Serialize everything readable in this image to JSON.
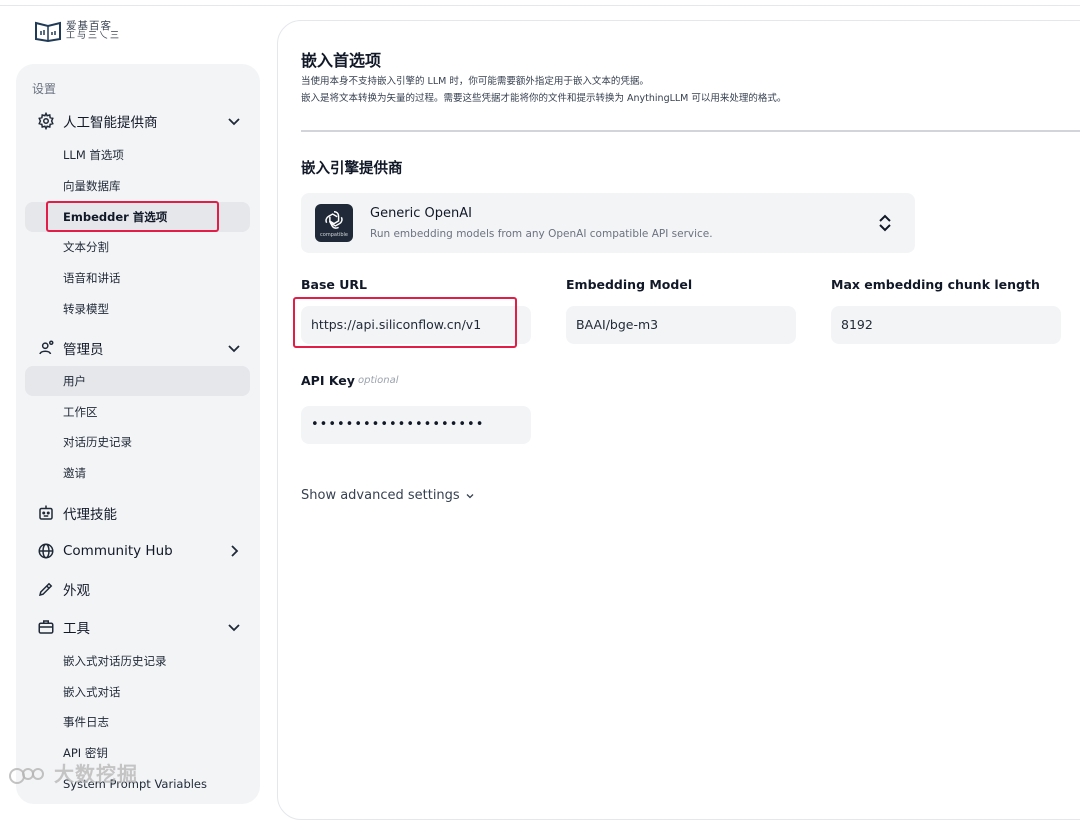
{
  "brand": {
    "line1": "爱基百客",
    "line2": "工与三乀三"
  },
  "sidebar": {
    "title": "设置",
    "groups": {
      "ai": {
        "label": "人工智能提供商",
        "items": [
          "LLM 首选项",
          "向量数据库",
          "Embedder 首选项",
          "文本分割",
          "语音和讲话",
          "转录模型"
        ]
      },
      "admin": {
        "label": "管理员",
        "items": [
          "用户",
          "工作区",
          "对话历史记录",
          "邀请"
        ]
      },
      "agent": {
        "label": "代理技能"
      },
      "community": {
        "label": "Community Hub"
      },
      "appearance": {
        "label": "外观"
      },
      "tools": {
        "label": "工具",
        "items": [
          "嵌入式对话历史记录",
          "嵌入式对话",
          "事件日志",
          "API 密钥",
          "System Prompt Variables"
        ]
      }
    }
  },
  "main": {
    "title": "嵌入首选项",
    "desc1": "当使用本身不支持嵌入引擎的 LLM 时，你可能需要额外指定用于嵌入文本的凭据。",
    "desc2": "嵌入是将文本转换为矢量的过程。需要这些凭据才能将你的文件和提示转换为 AnythingLLM 可以用来处理的格式。",
    "provider_heading": "嵌入引擎提供商",
    "provider": {
      "name": "Generic OpenAI",
      "desc": "Run embedding models from any OpenAI compatible API service.",
      "icon_sub": "compatible"
    },
    "fields": {
      "base_url": {
        "label": "Base URL",
        "value": "https://api.siliconflow.cn/v1"
      },
      "model": {
        "label": "Embedding Model",
        "value": "BAAI/bge-m3"
      },
      "chunk": {
        "label": "Max embedding chunk length",
        "value": "8192"
      },
      "api_key": {
        "label": "API Key",
        "optional": "optional",
        "value": "••••••••••••••••••••"
      }
    },
    "advanced": "Show advanced settings"
  },
  "watermark": "大数挖掘",
  "colors": {
    "highlight_box": "#e11d48",
    "sidebar_bg": "#f3f4f6",
    "field_bg": "#f3f4f6"
  }
}
